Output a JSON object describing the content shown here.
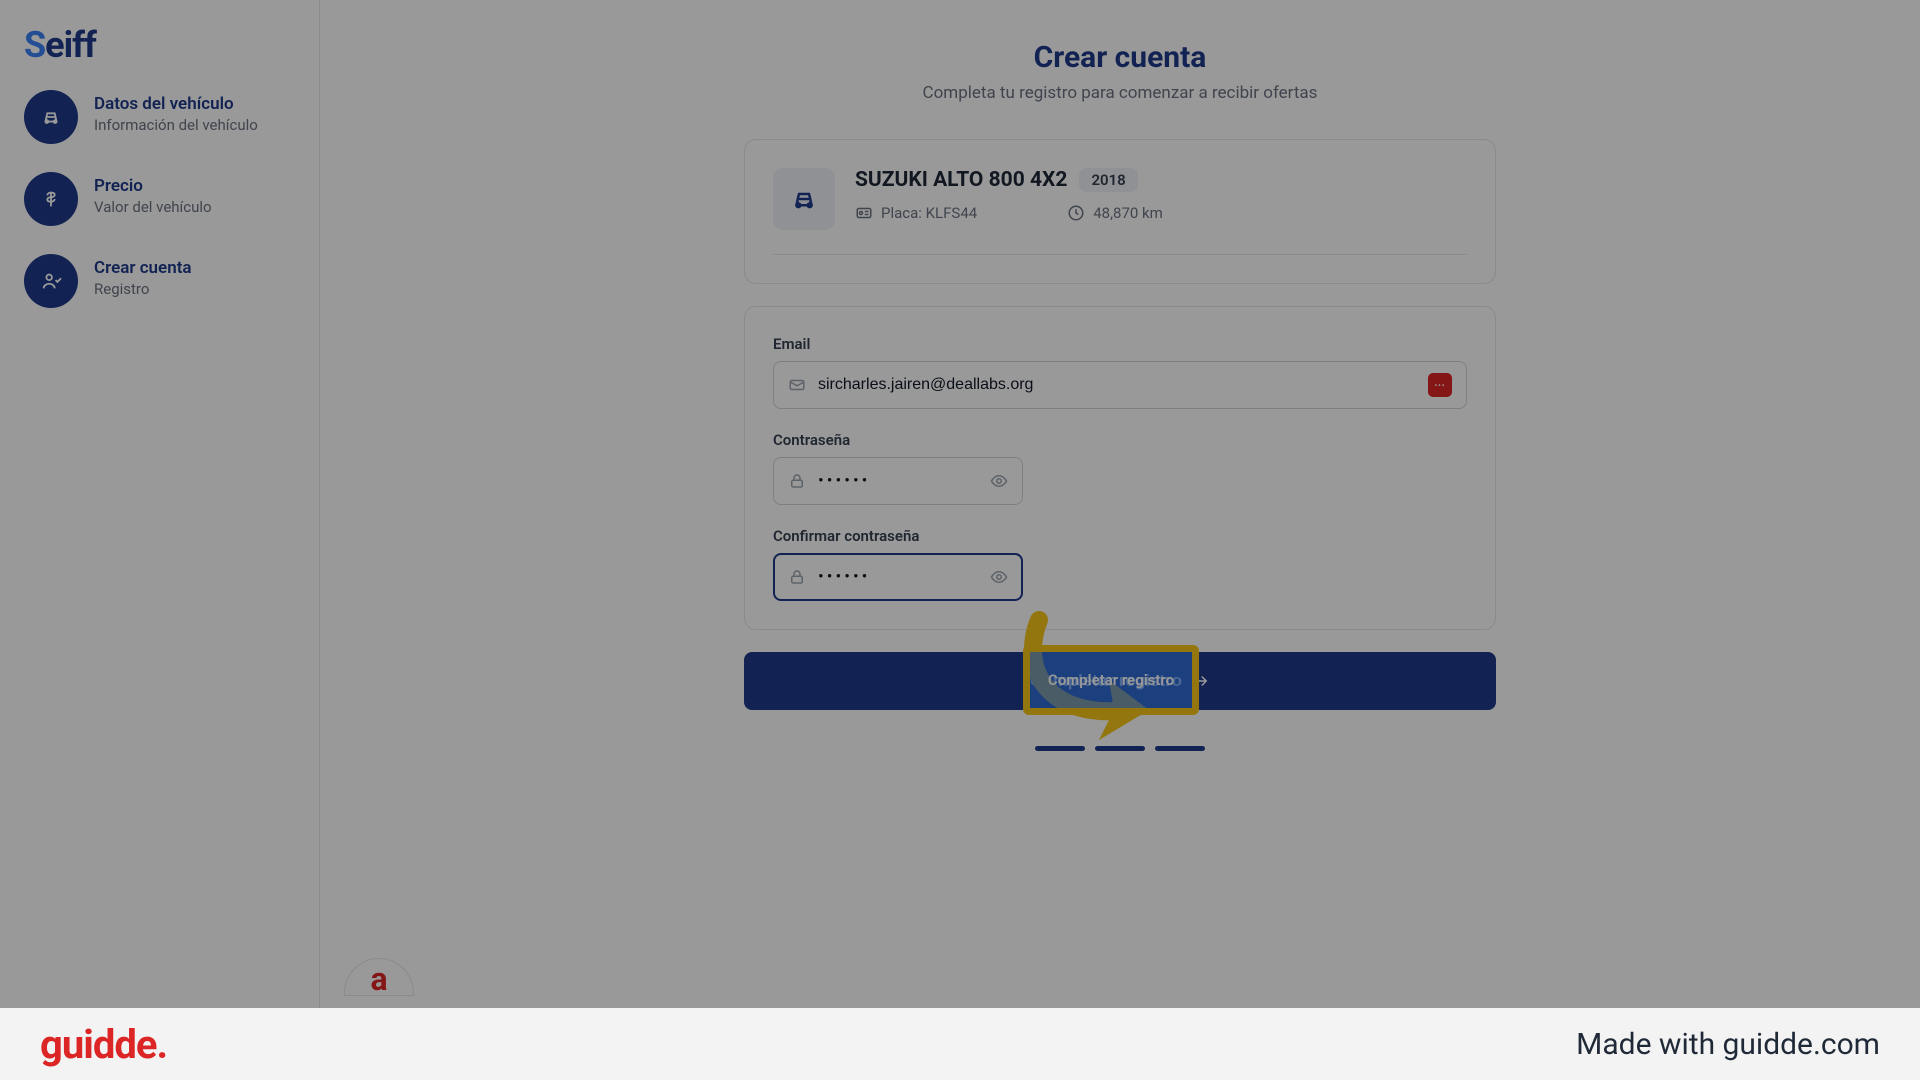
{
  "logo": {
    "text": "eiff",
    "prefix": "S"
  },
  "sidebar": {
    "step1": {
      "title": "Datos del vehículo",
      "sub": "Información del vehículo"
    },
    "step2": {
      "title": "Precio",
      "sub": "Valor del vehículo"
    },
    "step3": {
      "title": "Crear cuenta",
      "sub": "Registro"
    }
  },
  "heading": {
    "title": "Crear cuenta",
    "sub": "Completa tu registro para comenzar a recibir ofertas"
  },
  "vehicle": {
    "name": "SUZUKI ALTO 800 4X2",
    "year": "2018",
    "plate_label": "Placa: ",
    "plate_value": "KLFS44",
    "km_value": "48,870 km"
  },
  "form": {
    "email_label": "Email",
    "email_value": "sircharles.jairen@deallabs.org",
    "password_label": "Contraseña",
    "password_dots": "••••••",
    "confirm_label": "Confirmar contraseña",
    "confirm_dots": "••••••",
    "badge": "•••"
  },
  "submit": {
    "label": "Completar registro"
  },
  "highlight": {
    "label": "Completar registro"
  },
  "footer": {
    "brand": "guidde.",
    "madewith": "Made with guidde.com"
  }
}
